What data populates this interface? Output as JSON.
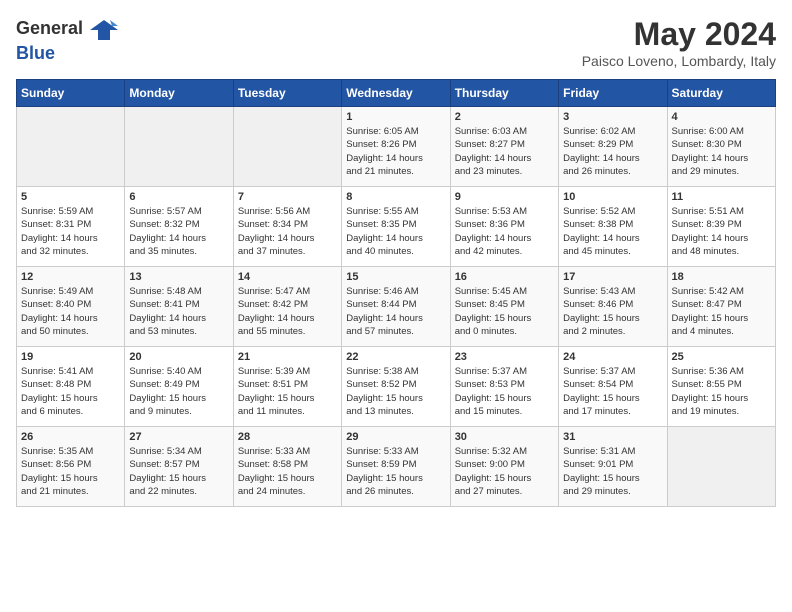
{
  "header": {
    "logo": {
      "general": "General",
      "blue": "Blue"
    },
    "title": "May 2024",
    "location": "Paisco Loveno, Lombardy, Italy"
  },
  "weekdays": [
    "Sunday",
    "Monday",
    "Tuesday",
    "Wednesday",
    "Thursday",
    "Friday",
    "Saturday"
  ],
  "weeks": [
    [
      {
        "day": "",
        "info": ""
      },
      {
        "day": "",
        "info": ""
      },
      {
        "day": "",
        "info": ""
      },
      {
        "day": "1",
        "info": "Sunrise: 6:05 AM\nSunset: 8:26 PM\nDaylight: 14 hours\nand 21 minutes."
      },
      {
        "day": "2",
        "info": "Sunrise: 6:03 AM\nSunset: 8:27 PM\nDaylight: 14 hours\nand 23 minutes."
      },
      {
        "day": "3",
        "info": "Sunrise: 6:02 AM\nSunset: 8:29 PM\nDaylight: 14 hours\nand 26 minutes."
      },
      {
        "day": "4",
        "info": "Sunrise: 6:00 AM\nSunset: 8:30 PM\nDaylight: 14 hours\nand 29 minutes."
      }
    ],
    [
      {
        "day": "5",
        "info": "Sunrise: 5:59 AM\nSunset: 8:31 PM\nDaylight: 14 hours\nand 32 minutes."
      },
      {
        "day": "6",
        "info": "Sunrise: 5:57 AM\nSunset: 8:32 PM\nDaylight: 14 hours\nand 35 minutes."
      },
      {
        "day": "7",
        "info": "Sunrise: 5:56 AM\nSunset: 8:34 PM\nDaylight: 14 hours\nand 37 minutes."
      },
      {
        "day": "8",
        "info": "Sunrise: 5:55 AM\nSunset: 8:35 PM\nDaylight: 14 hours\nand 40 minutes."
      },
      {
        "day": "9",
        "info": "Sunrise: 5:53 AM\nSunset: 8:36 PM\nDaylight: 14 hours\nand 42 minutes."
      },
      {
        "day": "10",
        "info": "Sunrise: 5:52 AM\nSunset: 8:38 PM\nDaylight: 14 hours\nand 45 minutes."
      },
      {
        "day": "11",
        "info": "Sunrise: 5:51 AM\nSunset: 8:39 PM\nDaylight: 14 hours\nand 48 minutes."
      }
    ],
    [
      {
        "day": "12",
        "info": "Sunrise: 5:49 AM\nSunset: 8:40 PM\nDaylight: 14 hours\nand 50 minutes."
      },
      {
        "day": "13",
        "info": "Sunrise: 5:48 AM\nSunset: 8:41 PM\nDaylight: 14 hours\nand 53 minutes."
      },
      {
        "day": "14",
        "info": "Sunrise: 5:47 AM\nSunset: 8:42 PM\nDaylight: 14 hours\nand 55 minutes."
      },
      {
        "day": "15",
        "info": "Sunrise: 5:46 AM\nSunset: 8:44 PM\nDaylight: 14 hours\nand 57 minutes."
      },
      {
        "day": "16",
        "info": "Sunrise: 5:45 AM\nSunset: 8:45 PM\nDaylight: 15 hours\nand 0 minutes."
      },
      {
        "day": "17",
        "info": "Sunrise: 5:43 AM\nSunset: 8:46 PM\nDaylight: 15 hours\nand 2 minutes."
      },
      {
        "day": "18",
        "info": "Sunrise: 5:42 AM\nSunset: 8:47 PM\nDaylight: 15 hours\nand 4 minutes."
      }
    ],
    [
      {
        "day": "19",
        "info": "Sunrise: 5:41 AM\nSunset: 8:48 PM\nDaylight: 15 hours\nand 6 minutes."
      },
      {
        "day": "20",
        "info": "Sunrise: 5:40 AM\nSunset: 8:49 PM\nDaylight: 15 hours\nand 9 minutes."
      },
      {
        "day": "21",
        "info": "Sunrise: 5:39 AM\nSunset: 8:51 PM\nDaylight: 15 hours\nand 11 minutes."
      },
      {
        "day": "22",
        "info": "Sunrise: 5:38 AM\nSunset: 8:52 PM\nDaylight: 15 hours\nand 13 minutes."
      },
      {
        "day": "23",
        "info": "Sunrise: 5:37 AM\nSunset: 8:53 PM\nDaylight: 15 hours\nand 15 minutes."
      },
      {
        "day": "24",
        "info": "Sunrise: 5:37 AM\nSunset: 8:54 PM\nDaylight: 15 hours\nand 17 minutes."
      },
      {
        "day": "25",
        "info": "Sunrise: 5:36 AM\nSunset: 8:55 PM\nDaylight: 15 hours\nand 19 minutes."
      }
    ],
    [
      {
        "day": "26",
        "info": "Sunrise: 5:35 AM\nSunset: 8:56 PM\nDaylight: 15 hours\nand 21 minutes."
      },
      {
        "day": "27",
        "info": "Sunrise: 5:34 AM\nSunset: 8:57 PM\nDaylight: 15 hours\nand 22 minutes."
      },
      {
        "day": "28",
        "info": "Sunrise: 5:33 AM\nSunset: 8:58 PM\nDaylight: 15 hours\nand 24 minutes."
      },
      {
        "day": "29",
        "info": "Sunrise: 5:33 AM\nSunset: 8:59 PM\nDaylight: 15 hours\nand 26 minutes."
      },
      {
        "day": "30",
        "info": "Sunrise: 5:32 AM\nSunset: 9:00 PM\nDaylight: 15 hours\nand 27 minutes."
      },
      {
        "day": "31",
        "info": "Sunrise: 5:31 AM\nSunset: 9:01 PM\nDaylight: 15 hours\nand 29 minutes."
      },
      {
        "day": "",
        "info": ""
      }
    ]
  ]
}
